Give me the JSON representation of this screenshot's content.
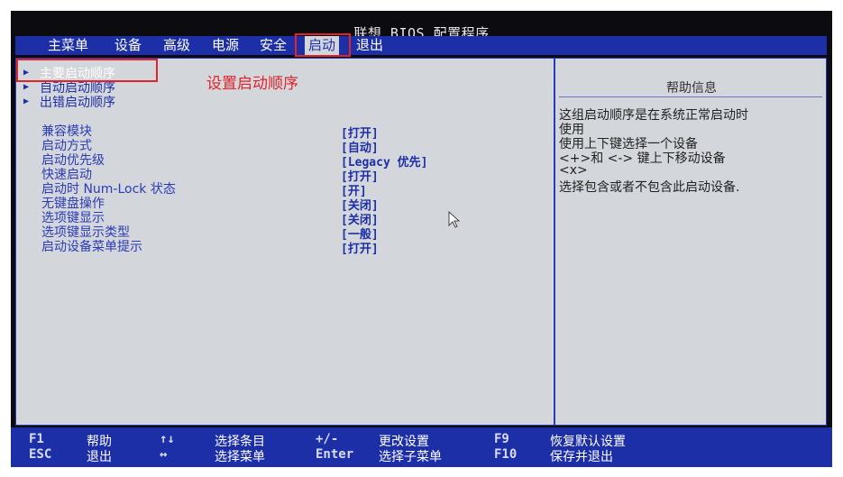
{
  "title": "联想 BIOS 配置程序",
  "menu": {
    "items": [
      "主菜单",
      "设备",
      "高级",
      "电源",
      "安全",
      "启动",
      "退出"
    ],
    "active": "启动"
  },
  "boot_sequences": [
    "主要启动顺序",
    "自动启动顺序",
    "出错启动顺序"
  ],
  "settings": [
    {
      "label": "兼容模块",
      "value": "[打开]"
    },
    {
      "label": "启动方式",
      "value": "[自动]"
    },
    {
      "label": "启动优先级",
      "value": "[Legacy 优先]"
    },
    {
      "label": "快速启动",
      "value": "[打开]"
    },
    {
      "label": "启动时 Num-Lock 状态",
      "value": "[开]"
    },
    {
      "label": "无键盘操作",
      "value": "[关闭]"
    },
    {
      "label": "选项键显示",
      "value": "[关闭]"
    },
    {
      "label": "选项键显示类型",
      "value": "[一般]"
    },
    {
      "label": "启动设备菜单提示",
      "value": "[打开]"
    }
  ],
  "help": {
    "title": "帮助信息",
    "lines": [
      "这组启动顺序是在系统正常启动时",
      "使用",
      "使用上下键选择一个设备",
      "<+>和 <-> 键上下移动设备",
      "<x>",
      "选择包含或者不包含此启动设备."
    ]
  },
  "annotation": "设置启动顺序",
  "footer": {
    "keys": [
      {
        "key": "F1",
        "desc": "帮助"
      },
      {
        "key": "ESC",
        "desc": "退出"
      },
      {
        "key": "↑↓",
        "desc": "选择条目"
      },
      {
        "key": "↔",
        "desc": "选择菜单"
      },
      {
        "key": "+/-",
        "desc": "更改设置"
      },
      {
        "key": "Enter",
        "desc": "选择子菜单"
      },
      {
        "key": "F9",
        "desc": "恢复默认设置"
      },
      {
        "key": "F10",
        "desc": "保存并退出"
      }
    ]
  },
  "colors": {
    "bios_blue": "#1d2fa6",
    "panel_gray": "#d3d6db",
    "highlight_red": "#e0242a"
  }
}
